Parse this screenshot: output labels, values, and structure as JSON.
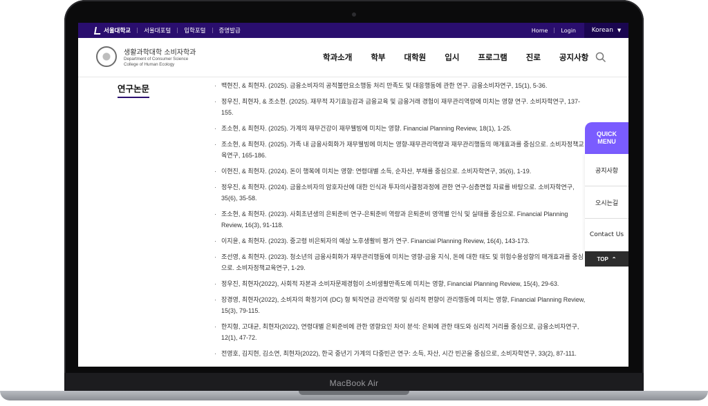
{
  "device": {
    "model": "MacBook Air"
  },
  "utility_bar": {
    "links": [
      "서울대학교",
      "서울대포털",
      "입학포털",
      "증명발급"
    ],
    "right_links": [
      "Home",
      "Login"
    ],
    "language": "Korean"
  },
  "header": {
    "logo_ko": "생활과학대학 소비자학과",
    "logo_en1": "Department of Consumer Science",
    "logo_en2": "College of Human Ecology",
    "nav": [
      "학과소개",
      "학부",
      "대학원",
      "입시",
      "프로그램",
      "진로",
      "공지사항"
    ]
  },
  "section_title": "연구논문",
  "papers": [
    "백현진, & 최현자. (2025). 금융소비자의 공적불만요소행동 처리 만족도 및 대응행동에 관한 연구. 금융소비자연구, 15(1), 5-36.",
    "정우진, 최현자, & 조소현. (2025). 재무적 자기효능감과 금융교육 및 금융거래 경험이 재무관리역량에 미치는 영향 연구. 소비자학연구, 137-155.",
    "조소현, & 최현자. (2025). 가계의 재무건강이 재무웰빙에 미치는 영향. Financial Planning Review, 18(1), 1-25.",
    "조소현, & 최현자. (2025). 가족 내 금융사회화가 재무웰빙에 미치는 영향-재무관리역량과 재무관리행동의 매개효과를 중심으로. 소비자정책교육연구, 165-186.",
    "이현진, & 최현자. (2024). 돈이 행복에 미치는 영향: 연령대별 소득, 순자산, 부채를 중심으로. 소비자학연구, 35(6), 1-19.",
    "정우진, & 최현자. (2024). 금융소비자의 암호자산에 대한 인식과 투자의사결정과정에 관한 연구-심층면접 자료를 바탕으로. 소비자학연구, 35(6), 35-58.",
    "조소현, & 최현자. (2023). 사회초년생의 은퇴준비 연구-은퇴준비 역량과 은퇴준비 영역별 인식 및 실태를 중심으로. Financial Planning Review, 16(3), 91-118.",
    "이지윤, & 최현자. (2023). 중고령 비은퇴자의 예상 노후생활비 평가 연구. Financial Planning Review, 16(4), 143-173.",
    "조선영, & 최현자. (2023). 청소년의 금융사회화가 재무관리행동에 미치는 영향-금융 지식, 돈에 대한 태도 및 위험수용성향의 매개효과를 중심으로. 소비자정책교육연구, 1-29.",
    "정우진, 최현자(2022), 사회적 자본과 소비자문제경험이 소비생활만족도에 미치는 영향, Financial Planning Review, 15(4), 29-63.",
    "장경영, 최현자(2022), 소비자의 확정기여 (DC) 형 퇴직연금 관리역량 및 심리적 편향이 관리행동에 미치는 영향, Financial Planning Review, 15(3), 79-115.",
    "한지형, 고대균, 최현자(2022), 연령대별 은퇴준비에 관한 영향요인 차이 분석: 은퇴에 관한 태도와 심리적 거리를 중심으로, 금융소비자연구, 12(1), 47-72.",
    "전영호, 김지현, 김소연, 최현자(2022), 한국 중년기 가계의 다중빈곤 연구: 소득, 자산, 시간 빈곤을 중심으로, 소비자학연구, 33(2), 87-111."
  ],
  "quick_menu": {
    "title_line1": "QUICK",
    "title_line2": "MENU",
    "items": [
      "공지사항",
      "오시는길",
      "Contact Us"
    ],
    "top_label": "TOP"
  },
  "colors": {
    "brand_purple": "#2a0e6e",
    "quick_accent": "#7a5cff"
  }
}
